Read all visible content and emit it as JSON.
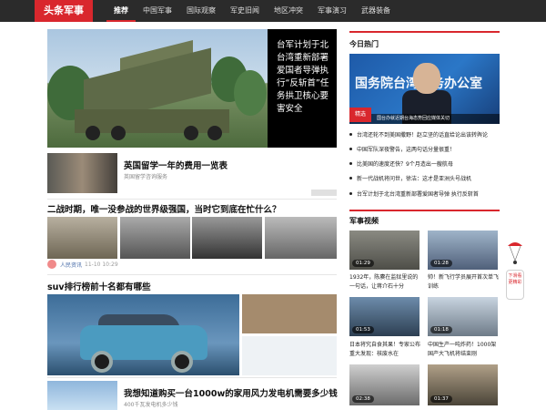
{
  "logo": "头条军事",
  "nav": [
    "推荐",
    "中国军事",
    "国际观察",
    "军史旧闻",
    "地区冲突",
    "军事演习",
    "武器装备"
  ],
  "hero": {
    "caption": "台军计划于北台湾重新部署爱国者导弹执行“反斩首”任务拱卫核心要害安全"
  },
  "hero2": {
    "title": "英国留学一年的费用一览表",
    "sub": "英国留学咨询服务"
  },
  "article": {
    "title": "二战时期，唯一没参战的世界级强国，当时它到底在忙什么？",
    "source": "人民资讯",
    "time": "11-10 10:29"
  },
  "suv": {
    "title": "suv排行榜前十名都有哪些"
  },
  "wind": {
    "title": "我想知道购买一台1000w的家用风力发电机需要多少钱",
    "sub": "400千瓦发电机多少钱"
  },
  "hot": {
    "heading": "今日热门",
    "board": "国务院台湾事务办公室",
    "caption": "国台办就近期台海态势回应媒体关切",
    "tag": "精选",
    "news": [
      "台湾还轮不到美国撒野！赵立坚的话直给论出该转舆论",
      "中国军队深夜警告，这两句话分量很重！",
      "比美国的速度还快？9个月造出一艘航母",
      "新一代战机将问世，徐洁：这才是亚洲头号战机",
      "台军计划于北台湾重新部署爱国者导弹 执行反斩首"
    ]
  },
  "video": {
    "heading": "军事视频",
    "items": [
      {
        "duration": "01:29",
        "caption": "1932年，陈赓在监狱里说的一句话，让蒋介石十分"
      },
      {
        "duration": "01:28",
        "caption": "帅！新飞行学员展开首次单飞训练"
      },
      {
        "duration": "01:53",
        "caption": "日本将究自食其果！专家公布重大发现：核废水在"
      },
      {
        "duration": "01:18",
        "caption": "中国生产一吨炸药！1000架国产大飞机将结束刚"
      },
      {
        "duration": "02:38",
        "caption": ""
      },
      {
        "duration": "01:37",
        "caption": ""
      }
    ]
  },
  "float_btn": "下滑看更精彩"
}
